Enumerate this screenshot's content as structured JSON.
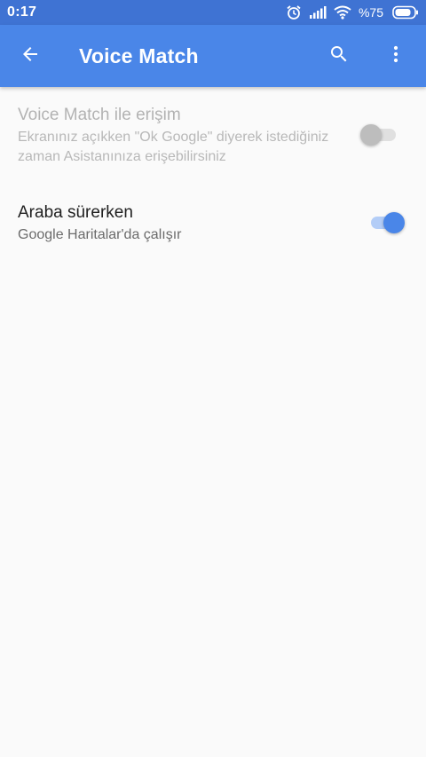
{
  "status_bar": {
    "time": "0:17",
    "battery": "%75",
    "icons": [
      "alarm-icon",
      "signal-icon",
      "wifi-icon",
      "battery-icon"
    ]
  },
  "app_bar": {
    "title": "Voice Match",
    "back_icon": "arrow-back-icon",
    "search_icon": "search-icon",
    "more_icon": "more-vertical-icon",
    "color": "#4a86e8"
  },
  "settings": [
    {
      "title": "Voice Match ile erişim",
      "subtitle": "Ekranınız açıkken \"Ok Google\" diyerek istediğiniz zaman Asistanınıza erişebilirsiniz",
      "enabled": false,
      "toggle_on": false
    },
    {
      "title": "Araba sürerken",
      "subtitle": "Google Haritalar'da çalışır",
      "enabled": true,
      "toggle_on": true
    }
  ],
  "colors": {
    "status_bar": "#3f73d3",
    "accent": "#4a86e8",
    "background": "#fafafa"
  }
}
